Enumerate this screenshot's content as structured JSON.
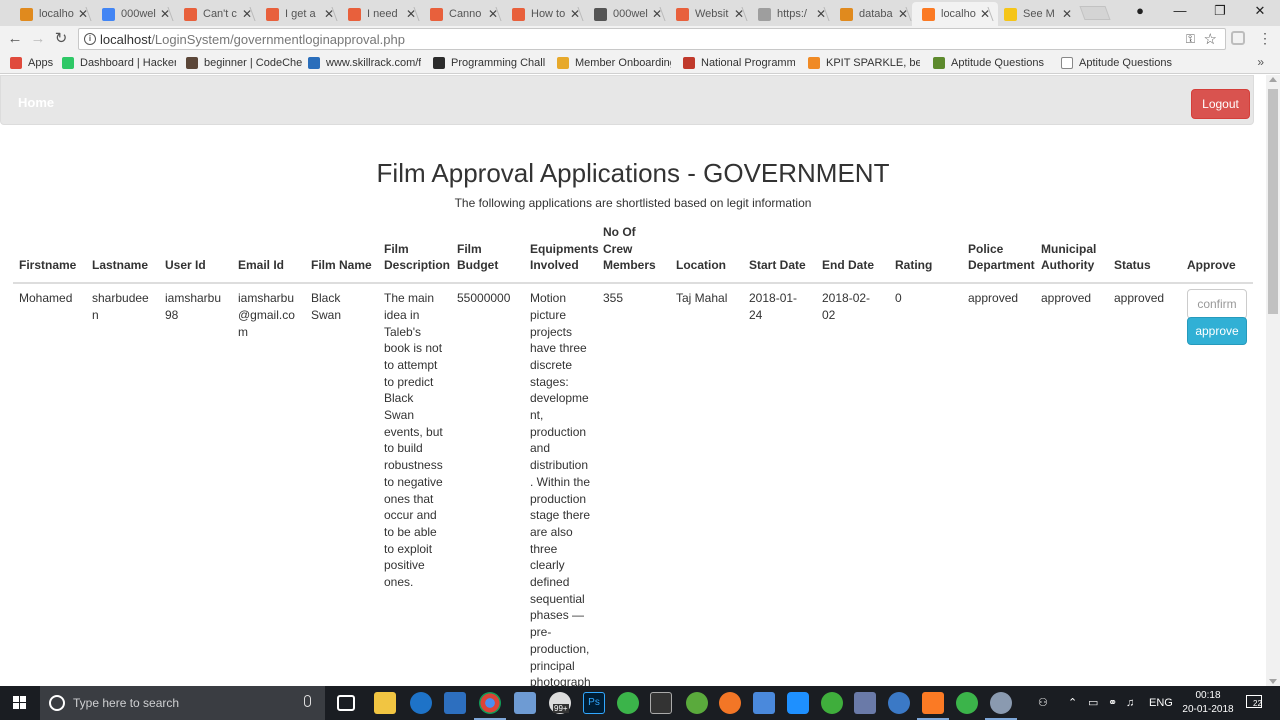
{
  "browser": {
    "tabs": [
      {
        "title": "localho",
        "icon": "xampp-icon",
        "color": "#e08a1e",
        "active": false
      },
      {
        "title": "000wel",
        "icon": "google-icon",
        "color": "#4285f4",
        "active": false
      },
      {
        "title": "Can't c",
        "icon": "stackoverflow-icon",
        "color": "#e8603c",
        "active": false
      },
      {
        "title": "I get a",
        "icon": "stackoverflow-icon",
        "color": "#e8603c",
        "active": false
      },
      {
        "title": "I need",
        "icon": "stackoverflow-icon",
        "color": "#e8603c",
        "active": false
      },
      {
        "title": "Canno",
        "icon": "stackoverflow-icon",
        "color": "#e8603c",
        "active": false
      },
      {
        "title": "How to",
        "icon": "stackoverflow-icon",
        "color": "#e8603c",
        "active": false
      },
      {
        "title": "000wel",
        "icon": "paw-icon",
        "color": "#555555",
        "active": false
      },
      {
        "title": "Websit",
        "icon": "stackoverflow-icon",
        "color": "#e8603c",
        "active": false
      },
      {
        "title": "https:/",
        "icon": "page-icon",
        "color": "#9e9e9e",
        "active": false
      },
      {
        "title": "databa",
        "icon": "xampp-icon",
        "color": "#e08a1e",
        "active": false
      },
      {
        "title": "localho",
        "icon": "xampp-icon",
        "color": "#fb7a24",
        "active": true
      },
      {
        "title": "See M",
        "icon": "lightning-icon",
        "color": "#f5c518",
        "active": false
      }
    ],
    "url_host": "localhost",
    "url_path": "/LoginSystem/governmentloginapproval.php",
    "bookmarks": [
      {
        "label": "Apps",
        "icon": "apps-grid-icon",
        "color": "#e04a3c"
      },
      {
        "label": "Dashboard | HackerR",
        "icon": "hackerrank-icon",
        "color": "#2ec866"
      },
      {
        "label": "beginner | CodeChef",
        "icon": "codechef-icon",
        "color": "#5b4638"
      },
      {
        "label": "www.skillrack.com/fa",
        "icon": "skillrack-icon",
        "color": "#2a6ebb"
      },
      {
        "label": "Programming Challe",
        "icon": "h-icon",
        "color": "#2b2b2b"
      },
      {
        "label": "Member Onboarding",
        "icon": "onboarding-icon",
        "color": "#e7a92b"
      },
      {
        "label": "National Programme",
        "icon": "n-icon",
        "color": "#c0392b"
      },
      {
        "label": "KPIT SPARKLE, beyon",
        "icon": "kpit-icon",
        "color": "#f08a24"
      },
      {
        "label": "Aptitude Questions a",
        "icon": "runner-icon",
        "color": "#5d8a2d"
      },
      {
        "label": "Aptitude Questions a",
        "icon": "page-icon",
        "color": "#ffffff"
      }
    ]
  },
  "nav": {
    "brand": "Home",
    "logout": "Logout"
  },
  "page": {
    "title": "Film Approval Applications - GOVERNMENT",
    "subtitle": "The following applications are shortlisted based on legit information"
  },
  "table": {
    "headers": [
      "Firstname",
      "Lastname",
      "User Id",
      "Email Id",
      "Film Name",
      "Film Description",
      "Film Budget",
      "Equipments Involved",
      "No Of Crew Members",
      "Location",
      "Start Date",
      "End Date",
      "Rating",
      "Police Department",
      "Municipal Authority",
      "Status",
      "Approve"
    ],
    "rows": [
      {
        "firstname": "Mohamed",
        "lastname": "sharbudeen",
        "user_id": "iamsharbu98",
        "email": "iamsharbu@gmail.com",
        "film_name": "Black Swan",
        "description": "The main idea in Taleb's book is not to attempt to predict Black Swan events, but to build robustness to negative ones that occur and to be able to exploit positive ones.",
        "budget": "55000000",
        "equipments": "Motion picture projects have three discrete stages: development, production and distribution. Within the production stage there are also three clearly defined sequential phases — pre-production, principal photography",
        "crew": "355",
        "location": "Taj Mahal",
        "start_date": "2018-01-24",
        "end_date": "2018-02-02",
        "rating": "0",
        "police": "approved",
        "municipal": "approved",
        "status": "approved",
        "confirm_placeholder": "confirm",
        "approve_label": "approve"
      }
    ]
  },
  "taskbar": {
    "search_placeholder": "Type here to search",
    "store_badge": "99+",
    "language": "ENG",
    "time": "00:18",
    "date": "20-01-2018",
    "notifications": "22"
  }
}
